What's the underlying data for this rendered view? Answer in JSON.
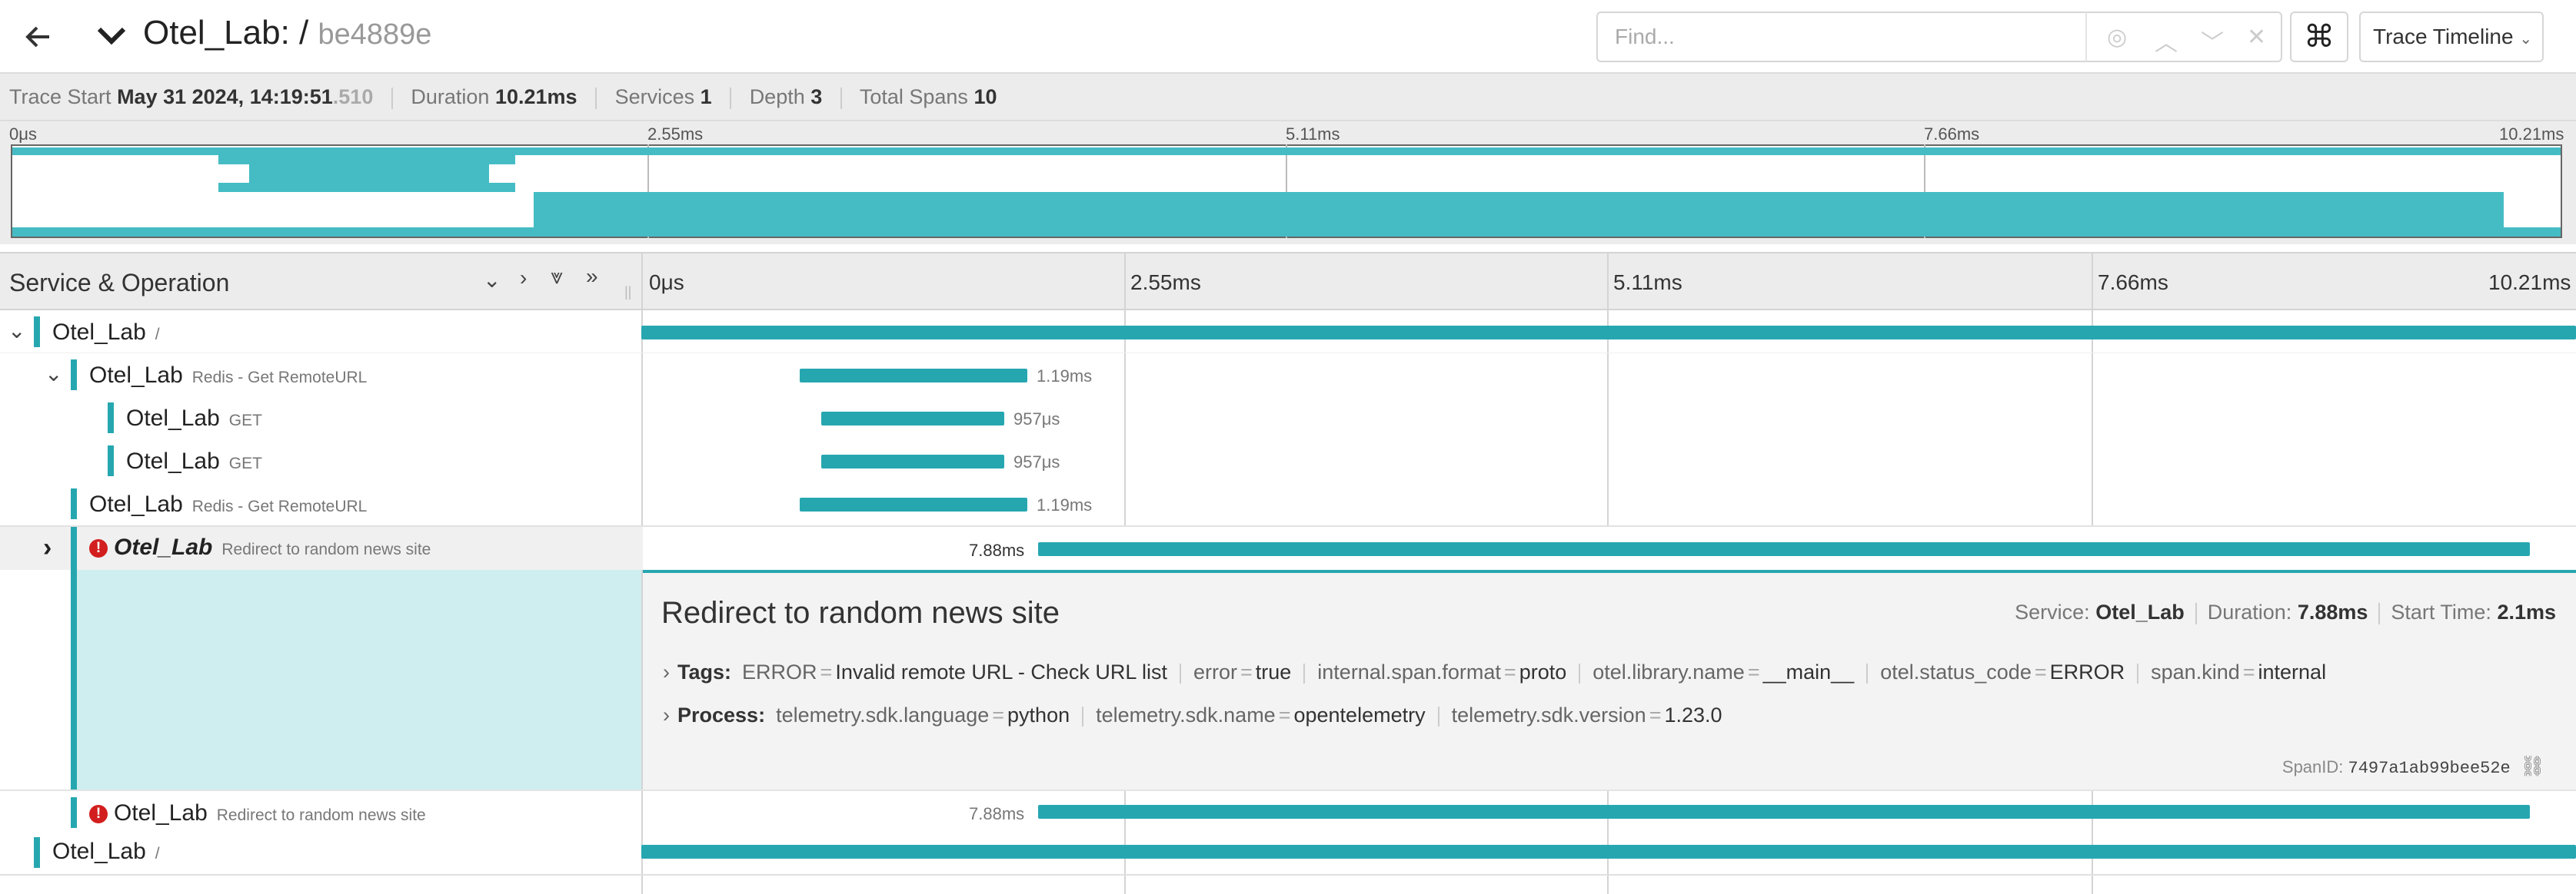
{
  "header": {
    "back_icon": "arrow-left-icon",
    "collapse_icon": "chevron-down-icon",
    "service": "Otel_Lab:",
    "slash": " / ",
    "trace_id": "be4889e",
    "find_placeholder": "Find...",
    "keyboard_icon": "⌘",
    "view_selector": "Trace Timeline"
  },
  "summary": {
    "trace_start_label": "Trace Start",
    "trace_start_value": "May 31 2024, 14:19:51",
    "trace_start_ms": ".510",
    "duration_label": "Duration",
    "duration_value": "10.21ms",
    "services_label": "Services",
    "services_value": "1",
    "depth_label": "Depth",
    "depth_value": "3",
    "total_spans_label": "Total Spans",
    "total_spans_value": "10"
  },
  "minimap": {
    "ticks": [
      "0μs",
      "2.55ms",
      "5.11ms",
      "7.66ms",
      "10.21ms"
    ]
  },
  "timeline": {
    "column_title": "Service & Operation",
    "ticks": [
      "0μs",
      "2.55ms",
      "5.11ms",
      "7.66ms",
      "10.21ms"
    ]
  },
  "rows": [
    {
      "service": "Otel_Lab",
      "operation": "/"
    },
    {
      "service": "Otel_Lab",
      "operation": "Redis - Get RemoteURL",
      "duration": "1.19ms"
    },
    {
      "service": "Otel_Lab",
      "operation": "GET",
      "duration": "957μs"
    },
    {
      "service": "Otel_Lab",
      "operation": "GET",
      "duration": "957μs"
    },
    {
      "service": "Otel_Lab",
      "operation": "Redis - Get RemoteURL",
      "duration": "1.19ms"
    },
    {
      "service": "Otel_Lab",
      "operation": "Redirect to random news site",
      "duration": "7.88ms"
    },
    {
      "service": "Otel_Lab",
      "operation": "Redirect to random news site",
      "duration": "7.88ms"
    },
    {
      "service": "Otel_Lab",
      "operation": "/"
    }
  ],
  "detail": {
    "title": "Redirect to random news site",
    "service_label": "Service:",
    "service_value": "Otel_Lab",
    "duration_label": "Duration:",
    "duration_value": "7.88ms",
    "start_label": "Start Time:",
    "start_value": "2.1ms",
    "tags_label": "Tags:",
    "tags": [
      {
        "k": "ERROR",
        "v": "Invalid remote URL - Check URL list"
      },
      {
        "k": "error",
        "v": "true"
      },
      {
        "k": "internal.span.format",
        "v": "proto"
      },
      {
        "k": "otel.library.name",
        "v": "__main__"
      },
      {
        "k": "otel.status_code",
        "v": "ERROR"
      },
      {
        "k": "span.kind",
        "v": "internal"
      }
    ],
    "process_label": "Process:",
    "process": [
      {
        "k": "telemetry.sdk.language",
        "v": "python"
      },
      {
        "k": "telemetry.sdk.name",
        "v": "opentelemetry"
      },
      {
        "k": "telemetry.sdk.version",
        "v": "1.23.0"
      }
    ],
    "spanid_label": "SpanID:",
    "spanid_value": "7497a1ab99bee52e"
  },
  "colors": {
    "accent": "#26a7b0",
    "error": "#d21e1e"
  }
}
